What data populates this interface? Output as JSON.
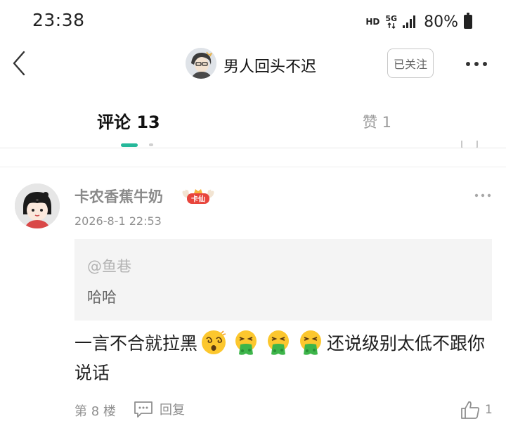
{
  "status_bar": {
    "time": "23:38",
    "hd": "HD",
    "network": "5G",
    "battery": "80%"
  },
  "header": {
    "back_icon": "chevron-left-icon",
    "title": "男人回头不迟",
    "follow_label": "已关注",
    "more_icon": "more-dots-icon"
  },
  "tabs": [
    {
      "label": "评论 13",
      "active": true
    },
    {
      "label": "赞 1",
      "active": false
    }
  ],
  "comment": {
    "username": "卡农香蕉牛奶",
    "badge_text": "卡仙",
    "time": "2026-8-1 22:53",
    "quote": {
      "user": "@鱼巷",
      "text": "哈哈"
    },
    "body_before": "一言不合就拉黑",
    "body_after": "还说级别太低不跟你说话",
    "emojis": [
      "dizzy-face-emoji",
      "vomiting-face-emoji",
      "vomiting-face-emoji",
      "vomiting-face-emoji"
    ],
    "floor": "第 8 楼",
    "reply_label": "回复",
    "like_count": "1"
  },
  "colors": {
    "accent": "#25b89a",
    "muted_text": "#8f8f8f",
    "quote_bg": "#f4f4f4"
  }
}
